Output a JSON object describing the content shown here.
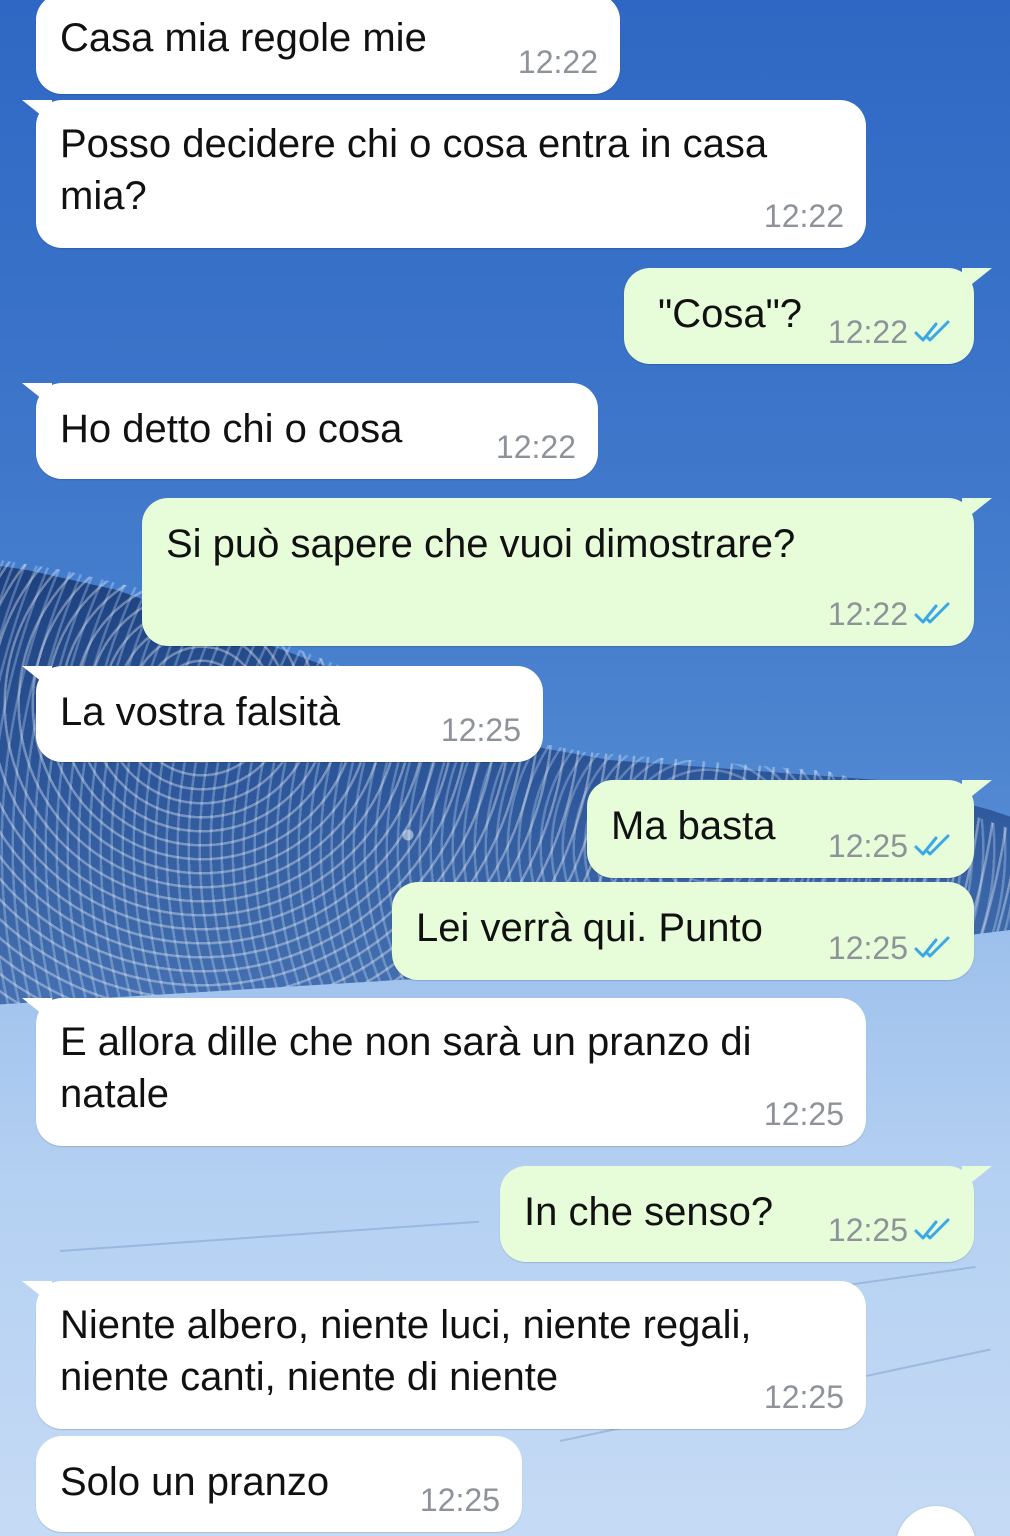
{
  "messages": [
    {
      "dir": "in",
      "text": "Casa mia regole mie",
      "time": "12:22"
    },
    {
      "dir": "in",
      "text_lines": [
        "Posso decidere chi o cosa entra in casa",
        "mia?"
      ],
      "time": "12:22"
    },
    {
      "dir": "out",
      "text": "\"Cosa\"?",
      "time": "12:22",
      "status": "read"
    },
    {
      "dir": "in",
      "text": "Ho detto chi o cosa",
      "time": "12:22"
    },
    {
      "dir": "out",
      "text": "Si può sapere che vuoi dimostrare?",
      "time": "12:22",
      "status": "read"
    },
    {
      "dir": "in",
      "text": "La vostra falsità",
      "time": "12:25"
    },
    {
      "dir": "out",
      "text": "Ma basta",
      "time": "12:25",
      "status": "read"
    },
    {
      "dir": "out",
      "text": "Lei verrà qui. Punto",
      "time": "12:25",
      "status": "read"
    },
    {
      "dir": "in",
      "text_lines": [
        "E allora dille che non sarà un pranzo di",
        "natale"
      ],
      "time": "12:25"
    },
    {
      "dir": "out",
      "text": "In che senso?",
      "time": "12:25",
      "status": "read"
    },
    {
      "dir": "in",
      "text_lines": [
        "Niente albero, niente luci, niente regali,",
        "niente canti, niente di niente"
      ],
      "time": "12:25"
    },
    {
      "dir": "in",
      "text": "Solo un pranzo",
      "time": "12:25"
    }
  ],
  "icons": {
    "read_status": "double-check-icon",
    "fab": "scroll-down-button"
  },
  "colors": {
    "incoming_bubble": "#ffffff",
    "outgoing_bubble": "#e7fcd9",
    "read_tick": "#3aa7e6",
    "time_text": "#8d9399"
  }
}
